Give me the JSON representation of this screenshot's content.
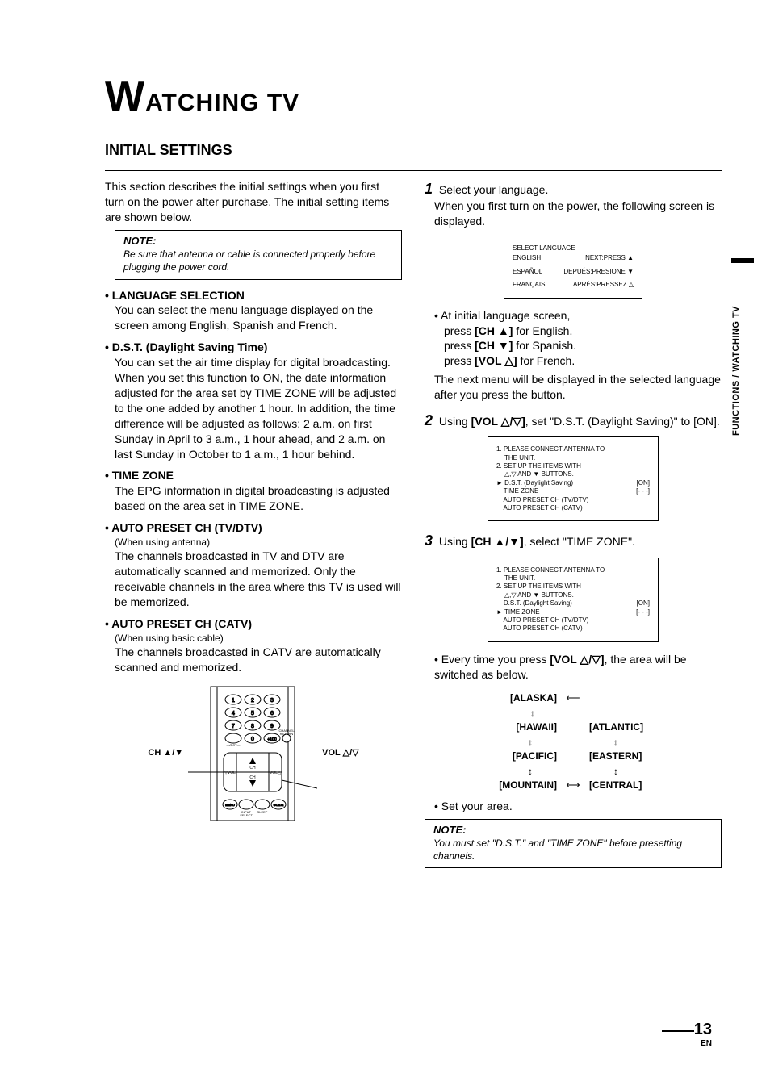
{
  "sideTab": "FUNCTIONS / WATCHING TV",
  "pageTitle": {
    "big": "W",
    "rest": "ATCHING TV"
  },
  "section": {
    "heading": "INITIAL SETTINGS",
    "intro": "This section describes the initial settings when you first turn on the power after purchase. The initial setting items are shown below.",
    "noteTop": {
      "hd": "NOTE:",
      "body": "Be sure that antenna or cable is connected properly before plugging the power cord."
    },
    "items": {
      "lang": {
        "head": "• LANGUAGE SELECTION",
        "body": "You can select the menu language displayed on the screen among English, Spanish and French."
      },
      "dst": {
        "head": "• D.S.T. (Daylight Saving Time)",
        "body": "You can set the air time display for digital broadcasting. When you set this function to ON, the date information adjusted for the area set by TIME ZONE will be adjusted to the one added by another 1 hour. In addition, the time difference will be adjusted as follows: 2 a.m. on first Sunday in April to 3 a.m., 1 hour ahead, and 2 a.m. on last Sunday in October to 1 a.m., 1 hour behind."
      },
      "tz": {
        "head": "• TIME ZONE",
        "body": "The EPG information in digital broadcasting is adjusted based on the area set in TIME ZONE."
      },
      "tvdtv": {
        "head": "• AUTO PRESET CH (TV/DTV)",
        "when": "(When using antenna)",
        "body": "The channels broadcasted in TV and DTV are automatically scanned and memorized. Only the receivable channels in the area where this TV is used will be memorized."
      },
      "catv": {
        "head": "• AUTO PRESET CH (CATV)",
        "when": "(When using basic cable)",
        "body": "The channels broadcasted in CATV are automatically scanned and memorized."
      }
    },
    "remote": {
      "chLabel": "CH ▲/▼",
      "volLabel": "VOL △/▽"
    }
  },
  "steps": {
    "s1": {
      "num": "1",
      "text1": "Select your language.",
      "text2": "When you first turn on the power, the following screen is displayed.",
      "screen": {
        "title": "SELECT LANGUAGE",
        "rows": [
          {
            "l": "ENGLISH",
            "r": "NEXT:PRESS ▲"
          },
          {
            "l": "ESPAÑOL",
            "r": "DEPUÉS:PRESIONE ▼"
          },
          {
            "l": "FRANÇAIS",
            "r": "APRÈS:PRESSEZ △"
          }
        ]
      },
      "bullets": {
        "intro": "At initial language screen,",
        "en": "press [CH ▲] for English.",
        "es": "press [CH ▼] for Spanish.",
        "fr": "press [VOL △] for French."
      },
      "after": "The next menu will be displayed in the selected language after you press the button."
    },
    "s2": {
      "num": "2",
      "text": "Using [VOL △/▽], set \"D.S.T. (Daylight Saving)\" to [ON].",
      "screen": {
        "l1": "1. PLEASE CONNECT ANTENNA TO",
        "l2a": "THE UNIT.",
        "l3": "2. SET UP THE ITEMS WITH",
        "l4a": "△,▽ AND ▼ BUTTONS.",
        "r1": {
          "l": "► D.S.T. (Daylight Saving)",
          "r": "[ON]"
        },
        "r2": {
          "l": "    TIME ZONE",
          "r": "[- - -]"
        },
        "r3": "    AUTO PRESET CH (TV/DTV)",
        "r4": "    AUTO PRESET CH (CATV)"
      }
    },
    "s3": {
      "num": "3",
      "text": "Using [CH ▲/▼], select \"TIME ZONE\".",
      "screen": {
        "l1": "1. PLEASE CONNECT ANTENNA TO",
        "l2a": "THE UNIT.",
        "l3": "2. SET UP THE ITEMS WITH",
        "l4a": "△,▽ AND ▼ BUTTONS.",
        "r1": {
          "l": "    D.S.T. (Daylight Saving)",
          "r": "[ON]"
        },
        "r2": {
          "l": "► TIME ZONE",
          "r": "[- - -]"
        },
        "r3": "    AUTO PRESET CH (TV/DTV)",
        "r4": "    AUTO PRESET CH (CATV)"
      },
      "switchText": "Every time you press [VOL △/▽], the area will be switched as below.",
      "zones": {
        "alaska": "[ALASKA]",
        "hawaii": "[HAWAII]",
        "pacific": "[PACIFIC]",
        "mountain": "[MOUNTAIN]",
        "atlantic": "[ATLANTIC]",
        "eastern": "[EASTERN]",
        "central": "[CENTRAL]"
      },
      "setArea": "• Set your area.",
      "noteBottom": {
        "hd": "NOTE:",
        "body": "You must set \"D.S.T.\" and \"TIME ZONE\" before presetting channels."
      }
    }
  },
  "footer": {
    "pageNum": "13",
    "lang": "EN"
  }
}
